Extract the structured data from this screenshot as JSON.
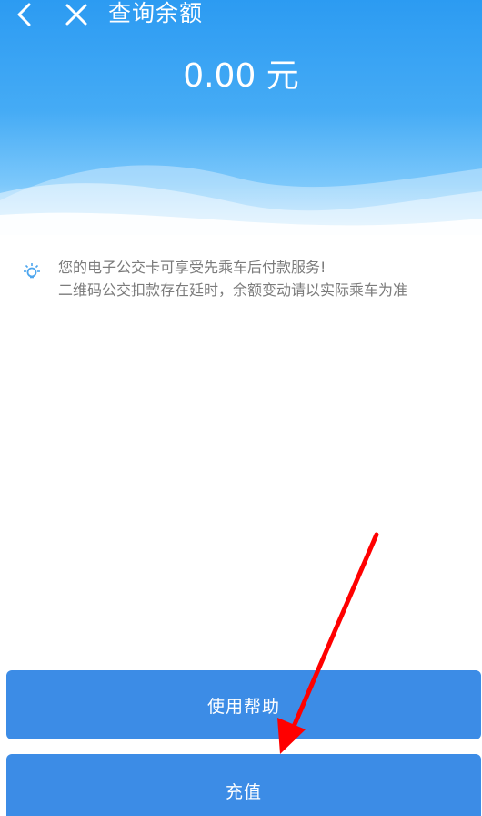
{
  "header": {
    "title": "查询余额",
    "balance": "0.00 元"
  },
  "tip": {
    "icon": "lightbulb-icon",
    "line1": "您的电子公交卡可享受先乘车后付款服务!",
    "line2": "二维码公交扣款存在延时，余额变动请以实际乘车为准"
  },
  "buttons": {
    "help_label": "使用帮助",
    "recharge_label": "充值"
  },
  "colors": {
    "header_top": "#2c9bf2",
    "button": "#3c8ce6",
    "annotation_arrow": "#ff0000"
  }
}
